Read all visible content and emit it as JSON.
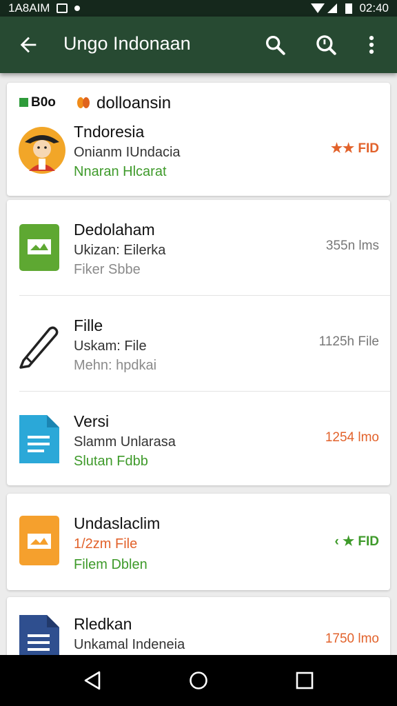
{
  "status_bar": {
    "left_text": "1A8AIM",
    "time": "02:40"
  },
  "app_bar": {
    "title": "Ungo Indonaan",
    "icons": [
      "arrow-back-icon",
      "search-icon",
      "zoom-search-icon",
      "more-vert-icon"
    ]
  },
  "header_card": {
    "badge": "B0o",
    "heading": "dolloansin",
    "item": {
      "name": "Tndoresia",
      "line1": "Onianm IUndacia",
      "line2": "Nnaran Hlcarat",
      "rating": "★★ FID",
      "icon": "avatar-illustration"
    }
  },
  "list_card": {
    "items": [
      {
        "name": "Dedolaham",
        "line1": "Ukizan: Eilerka",
        "line2": "Fiker Sbbe",
        "meta": "355n lms",
        "icon": "image-file-icon",
        "accent": "#5ea832"
      },
      {
        "name": "Fille",
        "line1": "Uskam: File",
        "line2": "Mehn: hpdkai",
        "meta": "1125h File",
        "icon": "pencil-icon",
        "accent": "#222222"
      },
      {
        "name": "Versi",
        "line1": "Slamm Unlarasa",
        "line2": "Slutan Fdbb",
        "meta": "1254 lmo",
        "icon": "document-icon",
        "accent": "#2ba8d8"
      }
    ]
  },
  "list_card2": {
    "items": [
      {
        "name": "Undaslaclim",
        "line1": "1/2zm File",
        "line2": "Filem Dblen",
        "rating": "‹ ★ FID",
        "icon": "image-file-icon",
        "accent": "#f5a02d"
      }
    ]
  },
  "list_card3": {
    "items": [
      {
        "name": "Rledkan",
        "line1": "Unkamal Indeneia",
        "meta": "1750 lmo",
        "icon": "document-icon",
        "accent": "#2f4f8f"
      }
    ]
  },
  "nav_bar": {
    "icons": [
      "nav-back-icon",
      "nav-home-icon",
      "nav-recents-icon"
    ]
  }
}
